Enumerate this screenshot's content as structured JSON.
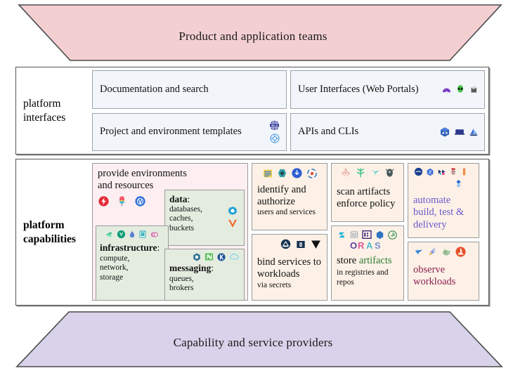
{
  "top_band": {
    "label": "Product and application teams",
    "fill": "#f4cfd2"
  },
  "bottom_band": {
    "label": "Capability and service providers",
    "fill": "#d8d2ea"
  },
  "interfaces": {
    "row_label_line1": "platform",
    "row_label_line2": "interfaces",
    "boxes": [
      {
        "label": "Documentation and search",
        "icons": []
      },
      {
        "label": "User Interfaces (Web Portals)",
        "icons": [
          "backstage-icon",
          "alien-icon",
          "port-icon"
        ]
      },
      {
        "label": "Project and environment templates",
        "icons": [
          "helm-icon",
          "crossplane-icon"
        ]
      },
      {
        "label": "APIs and CLIs",
        "icons": [
          "kubernetes-cube-icon",
          "terminal-icon",
          "cli-sail-icon"
        ]
      }
    ]
  },
  "capabilities": {
    "row_label_line1": "platform",
    "row_label_line2": "capabilities",
    "provide": {
      "title": "provide environments and resources",
      "icons": [
        "crossplane-icon",
        "humanitec-icon",
        "kubevela-icon"
      ],
      "fill": "#fdeef1"
    },
    "data": {
      "title_bold": "data",
      "title_rest": ":",
      "sub": "databases, caches, buckets",
      "icons": [
        "percona-gear-icon",
        "vitess-icon"
      ],
      "fill": "#e4ece0"
    },
    "infrastructure": {
      "title_bold": "infrastructure",
      "title_rest": ":",
      "sub": "compute, network, storage",
      "icons": [
        "cluster-api-icon",
        "shield-icon",
        "terraform-drop-icon",
        "pulumi-icon",
        "cloud-swirl-icon"
      ],
      "fill": "#e4ece0"
    },
    "messaging": {
      "title_bold": "messaging",
      "title_rest": ":",
      "sub": "queues, brokers",
      "icons": [
        "rabbitmq-icon",
        "nats-icon",
        "kafka-icon",
        "cloud-events-icon"
      ],
      "fill": "#e4ece0"
    },
    "identify": {
      "title": "identify and authorize",
      "sub": "users and services",
      "icons": [
        "spiffe-icon",
        "keycloak-icon",
        "oidc-icon",
        "dex-icon"
      ],
      "fill": "#fdf1e7"
    },
    "bind": {
      "title": "bind services to workloads",
      "sub": "via secrets",
      "icons": [
        "external-secrets-icon",
        "sealed-secrets-icon",
        "vault-icon"
      ],
      "fill": "#fdf1e7"
    },
    "scan": {
      "title_line1": "scan artifacts",
      "title_line2": "enforce policy",
      "icons": [
        "opa-icon",
        "kyverno-icon",
        "falco-icon",
        "trivy-icon"
      ],
      "fill": "#fdf1e7"
    },
    "store": {
      "title_black": "store ",
      "title_green": "artifacts",
      "sub": "in registries and repos",
      "icons": [
        "zot-icon",
        "harbor-icon",
        "oci-icon",
        "dragonfly-icon",
        "notary-icon",
        "oras-icon"
      ],
      "fill": "#fdf1e7"
    },
    "automate": {
      "title": "automate build, test & delivery",
      "icons": [
        "argo-icon",
        "flux-icon",
        "tekton-icon",
        "jenkins-icon",
        "gitlab-icon",
        "spinnaker-icon"
      ],
      "fill": "#fdf1e7",
      "text_color": "#6a5acd"
    },
    "observe": {
      "title": "observe workloads",
      "icons": [
        "jaeger-icon",
        "otel-rocket-icon",
        "grafana-pig-icon",
        "prometheus-flame-icon"
      ],
      "fill": "#fdf1e7",
      "text_color": "#8b2252"
    }
  }
}
